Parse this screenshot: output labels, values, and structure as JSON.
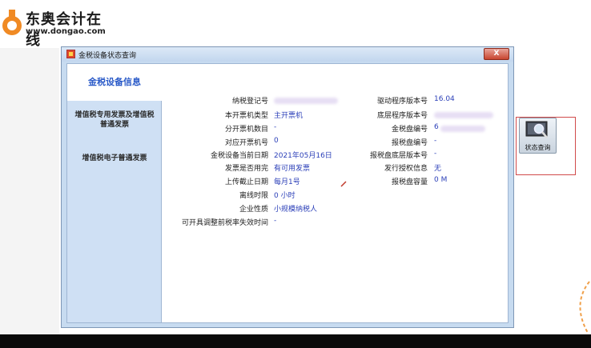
{
  "logo": {
    "name": "东奥会计在线",
    "url": "www.dongao.com"
  },
  "window": {
    "title": "金税设备状态查询",
    "close_label": "X"
  },
  "tabs": {
    "active": "金税设备信息",
    "special_invoice": "增值税专用发票及增值税普通发票",
    "electronic_invoice": "增值税电子普通发票"
  },
  "fields_left": [
    {
      "label": "纳税登记号",
      "value": ""
    },
    {
      "label": "本开票机类型",
      "value": "主开票机"
    },
    {
      "label": "分开票机数目",
      "value": "-"
    },
    {
      "label": "对应开票机号",
      "value": "0"
    },
    {
      "label": "金税设备当前日期",
      "value": "2021年05月16日"
    },
    {
      "label": "发票是否用完",
      "value": "有可用发票"
    },
    {
      "label": "上传截止日期",
      "value": "每月1号"
    },
    {
      "label": "离线时限",
      "value": "0 小时"
    },
    {
      "label": "企业性质",
      "value": "小规模纳税人"
    },
    {
      "label": "可开具调整前税率失效时间",
      "value": "-"
    }
  ],
  "fields_right": [
    {
      "label": "驱动程序版本号",
      "value": "16.04"
    },
    {
      "label": "底层程序版本号",
      "value": ""
    },
    {
      "label": "金税盘编号",
      "value": "6"
    },
    {
      "label": "报税盘编号",
      "value": "-"
    },
    {
      "label": "报税盘底层版本号",
      "value": "-"
    },
    {
      "label": "发行授权信息",
      "value": "无"
    },
    {
      "label": "报税盘容量",
      "value": "0 M"
    }
  ],
  "status_button": {
    "label": "状态查询",
    "icon": "magnifier-screen-icon"
  }
}
